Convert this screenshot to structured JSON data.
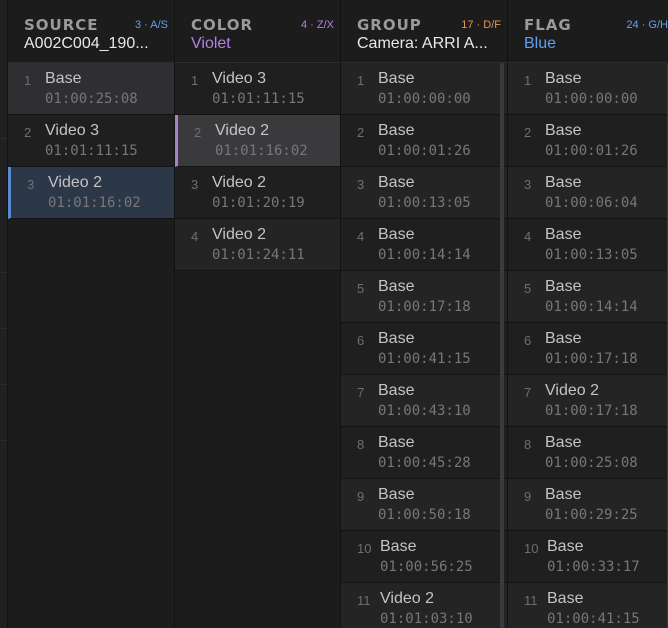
{
  "accent_colors": {
    "blue": "#5fa0f2",
    "violet": "#b580e4",
    "orange": "#e09a48",
    "white": "#e8e8ea"
  },
  "panels": [
    {
      "title": "SOURCE",
      "hint": "3 · A/S",
      "hint_color": "#5fa0f2",
      "value": "A002C004_190...",
      "value_color": "#e8e8ea",
      "rows": [
        {
          "index": "1",
          "name": "Base",
          "timecode": "01:00:25:08",
          "state": "highlight"
        },
        {
          "index": "2",
          "name": "Video 3",
          "timecode": "01:01:11:15",
          "state": "alt"
        },
        {
          "index": "3",
          "name": "Video 2",
          "timecode": "01:01:16:02",
          "state": "selected"
        }
      ]
    },
    {
      "title": "COLOR",
      "hint": "4 · Z/X",
      "hint_color": "#b580e4",
      "value": "Violet",
      "value_color": "#b580e4",
      "rows": [
        {
          "index": "1",
          "name": "Video 3",
          "timecode": "01:01:11:15",
          "state": "alt"
        },
        {
          "index": "2",
          "name": "Video 2",
          "timecode": "01:01:16:02",
          "state": "current"
        },
        {
          "index": "3",
          "name": "Video 2",
          "timecode": "01:01:20:19",
          "state": "alt"
        },
        {
          "index": "4",
          "name": "Video 2",
          "timecode": "01:01:24:11",
          "state": "normal"
        }
      ]
    },
    {
      "title": "GROUP",
      "hint": "17 · D/F",
      "hint_color": "#e09a48",
      "value": "Camera: ARRI A...",
      "value_color": "#e8e8ea",
      "rows": [
        {
          "index": "1",
          "name": "Base",
          "timecode": "01:00:00:00",
          "state": "normal"
        },
        {
          "index": "2",
          "name": "Base",
          "timecode": "01:00:01:26",
          "state": "alt"
        },
        {
          "index": "3",
          "name": "Base",
          "timecode": "01:00:13:05",
          "state": "normal"
        },
        {
          "index": "4",
          "name": "Base",
          "timecode": "01:00:14:14",
          "state": "alt"
        },
        {
          "index": "5",
          "name": "Base",
          "timecode": "01:00:17:18",
          "state": "normal"
        },
        {
          "index": "6",
          "name": "Base",
          "timecode": "01:00:41:15",
          "state": "alt"
        },
        {
          "index": "7",
          "name": "Base",
          "timecode": "01:00:43:10",
          "state": "normal"
        },
        {
          "index": "8",
          "name": "Base",
          "timecode": "01:00:45:28",
          "state": "alt"
        },
        {
          "index": "9",
          "name": "Base",
          "timecode": "01:00:50:18",
          "state": "normal"
        },
        {
          "index": "10",
          "name": "Base",
          "timecode": "01:00:56:25",
          "state": "alt"
        },
        {
          "index": "11",
          "name": "Video 2",
          "timecode": "01:01:03:10",
          "state": "normal"
        }
      ]
    },
    {
      "title": "FLAG",
      "hint": "24 · G/H",
      "hint_color": "#5fa0f2",
      "value": "Blue",
      "value_color": "#5fa0f2",
      "rows": [
        {
          "index": "1",
          "name": "Base",
          "timecode": "01:00:00:00",
          "state": "normal"
        },
        {
          "index": "2",
          "name": "Base",
          "timecode": "01:00:01:26",
          "state": "alt"
        },
        {
          "index": "3",
          "name": "Base",
          "timecode": "01:00:06:04",
          "state": "normal"
        },
        {
          "index": "4",
          "name": "Base",
          "timecode": "01:00:13:05",
          "state": "alt"
        },
        {
          "index": "5",
          "name": "Base",
          "timecode": "01:00:14:14",
          "state": "normal"
        },
        {
          "index": "6",
          "name": "Base",
          "timecode": "01:00:17:18",
          "state": "alt"
        },
        {
          "index": "7",
          "name": "Video 2",
          "timecode": "01:00:17:18",
          "state": "normal"
        },
        {
          "index": "8",
          "name": "Base",
          "timecode": "01:00:25:08",
          "state": "alt"
        },
        {
          "index": "9",
          "name": "Base",
          "timecode": "01:00:29:25",
          "state": "normal"
        },
        {
          "index": "10",
          "name": "Base",
          "timecode": "01:00:33:17",
          "state": "alt"
        },
        {
          "index": "11",
          "name": "Base",
          "timecode": "01:00:41:15",
          "state": "normal"
        }
      ]
    }
  ]
}
